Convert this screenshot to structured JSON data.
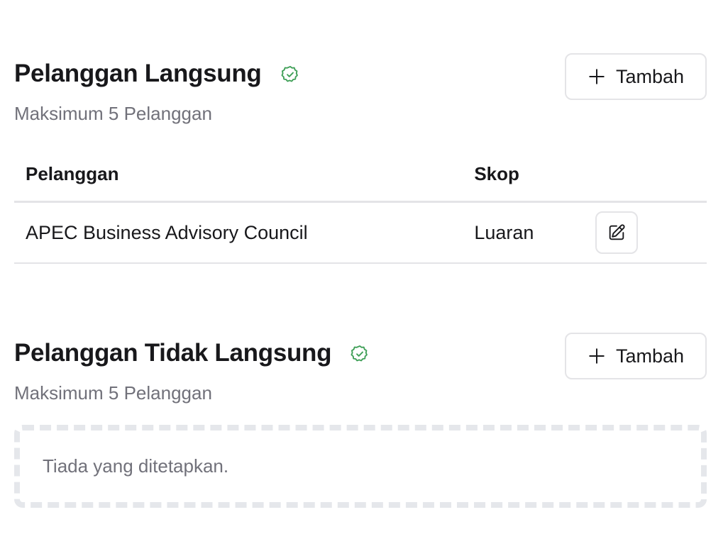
{
  "direct_customers": {
    "title": "Pelanggan Langsung",
    "subtitle": "Maksimum 5 Pelanggan",
    "add_label": "Tambah",
    "columns": {
      "name": "Pelanggan",
      "scope": "Skop"
    },
    "rows": [
      {
        "name": "APEC Business Advisory Council",
        "scope": "Luaran"
      }
    ]
  },
  "indirect_customers": {
    "title": "Pelanggan Tidak Langsung",
    "subtitle": "Maksimum 5 Pelanggan",
    "add_label": "Tambah",
    "empty_text": "Tiada yang ditetapkan."
  },
  "icons": {
    "verified": "badge-check-icon",
    "add": "plus-icon",
    "edit": "pencil-square-icon"
  },
  "colors": {
    "verified": "#3f9f57",
    "border": "#e4e4e7",
    "muted_text": "#71717a"
  }
}
